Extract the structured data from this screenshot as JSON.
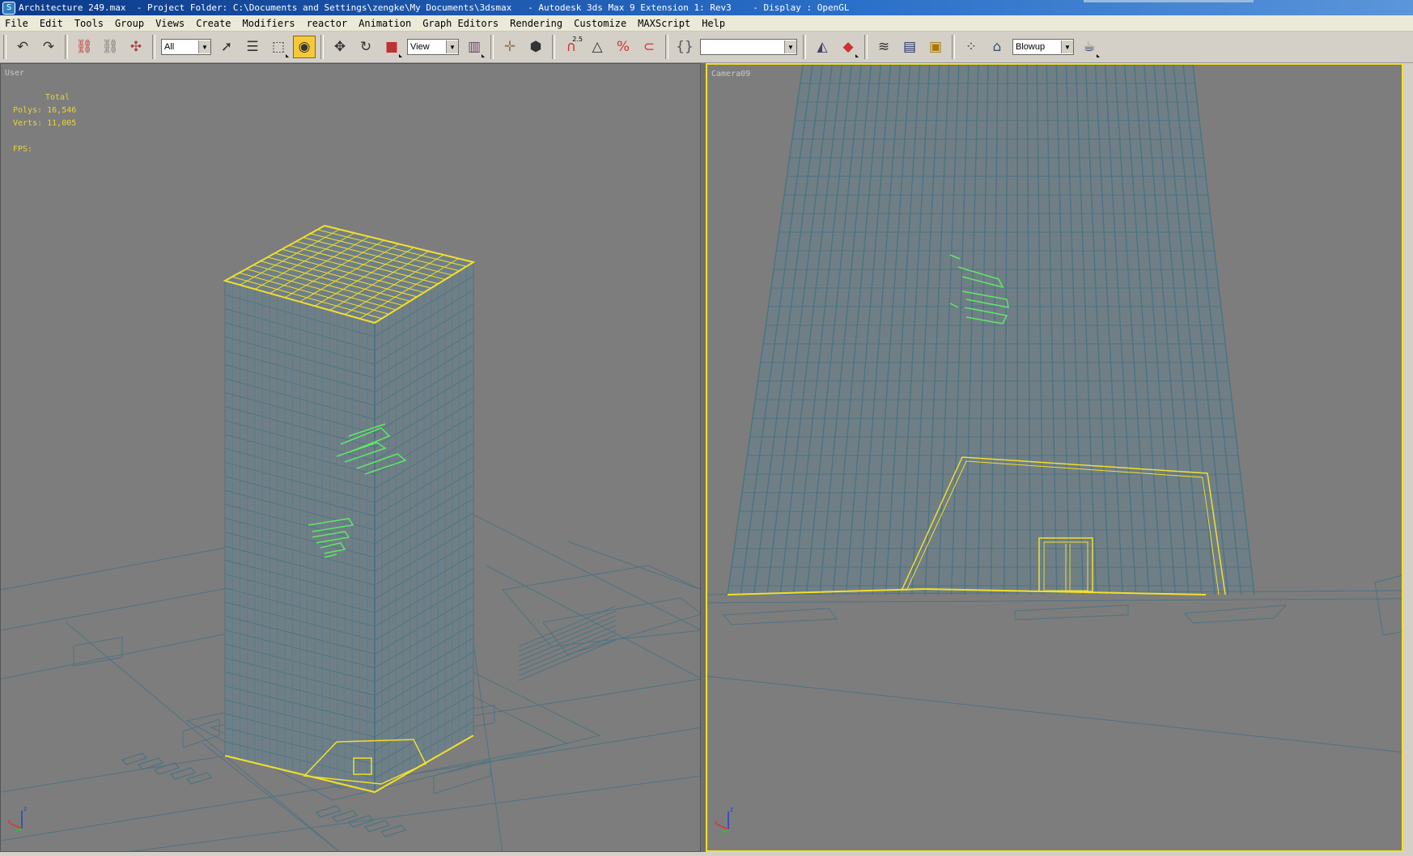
{
  "window": {
    "title_file": "Architecture 249.max",
    "title_project": "  - Project Folder: C:\\Documents and Settings\\zengke\\My Documents\\3dsmax",
    "title_app": "   - Autodesk 3ds Max 9 Extension 1: Rev3",
    "title_display": "    - Display : OpenGL"
  },
  "menu": {
    "items": [
      "File",
      "Edit",
      "Tools",
      "Group",
      "Views",
      "Create",
      "Modifiers",
      "reactor",
      "Animation",
      "Graph Editors",
      "Rendering",
      "Customize",
      "MAXScript",
      "Help"
    ]
  },
  "toolbar": {
    "selection_filter": "All",
    "reference_coord": "View",
    "named_selection": "",
    "render_preset": "Blowup",
    "snap_value_label": "2.5"
  },
  "icons": {
    "undo": "undo-icon",
    "redo": "redo-icon",
    "link": "select-and-link-icon",
    "unlink": "unlink-icon",
    "bind": "bind-space-warp-icon",
    "select": "select-object-icon",
    "select_by_name": "select-by-name-icon",
    "region": "rectangular-selection-icon",
    "window_crossing": "window-crossing-icon",
    "move": "move-icon",
    "rotate": "rotate-icon",
    "scale": "scale-icon",
    "pivot": "use-pivot-center-icon",
    "manipulate": "manipulate-icon",
    "keyboard_override": "keyboard-shortcut-override-icon",
    "snap": "snap-toggle-icon",
    "angle_snap": "angle-snap-icon",
    "percent_snap": "percent-snap-icon",
    "spinner_snap": "spinner-snap-icon",
    "edit_named": "edit-named-selection-icon",
    "mirror": "mirror-icon",
    "align": "align-icon",
    "layer": "layer-manager-icon",
    "curve_editor": "curve-editor-icon",
    "schematic": "schematic-view-icon",
    "material_editor": "material-editor-icon",
    "render_scene": "render-scene-icon",
    "quick_render": "quick-render-teapot-icon"
  },
  "viewports": {
    "left": {
      "label": "User",
      "stats_header": "Total",
      "polys": "Polys: 16,546",
      "verts": "Verts: 11,005",
      "fps": "FPS:"
    },
    "right": {
      "label": "Camera09"
    }
  },
  "colors": {
    "wire": "#4e7382",
    "selected": "#f2df2c",
    "green": "#5fe864",
    "viewport_bg": "#7d7d7d"
  }
}
